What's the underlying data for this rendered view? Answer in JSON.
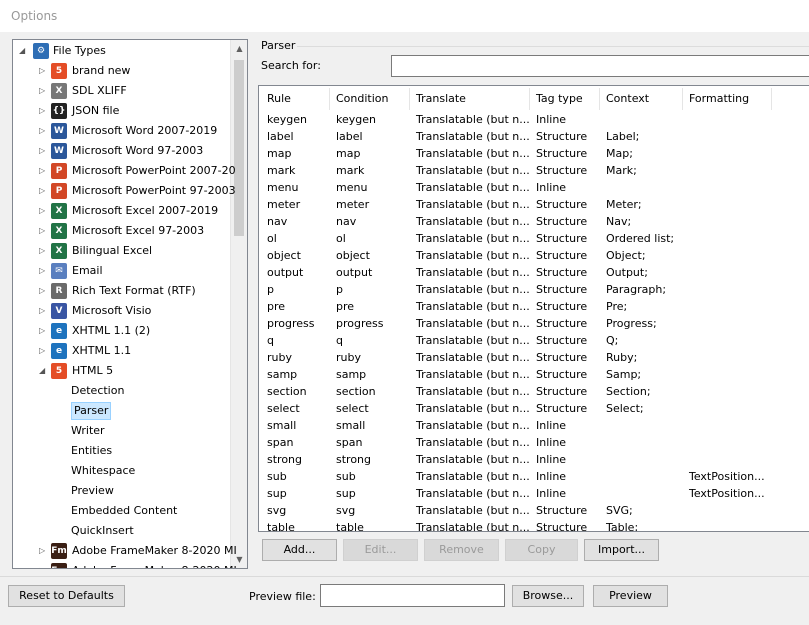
{
  "window": {
    "title": "Options"
  },
  "tree": {
    "items": [
      {
        "label": "File Types",
        "icon": "gear-icon",
        "color": "#2e6eb5",
        "glyph": "⚙"
      },
      {
        "label": "brand new",
        "icon": "html5-icon",
        "color": "#e44d26",
        "glyph": "5"
      },
      {
        "label": "SDL XLIFF",
        "icon": "xliff-icon",
        "color": "#777777",
        "glyph": "X"
      },
      {
        "label": "JSON file",
        "icon": "json-icon",
        "color": "#222222",
        "glyph": "{}"
      },
      {
        "label": "Microsoft Word 2007-2019",
        "icon": "word-icon",
        "color": "#2b579a",
        "glyph": "W"
      },
      {
        "label": "Microsoft Word 97-2003",
        "icon": "word-old-icon",
        "color": "#2b579a",
        "glyph": "W"
      },
      {
        "label": "Microsoft PowerPoint 2007-20",
        "icon": "powerpoint-icon",
        "color": "#d24726",
        "glyph": "P"
      },
      {
        "label": "Microsoft PowerPoint 97-2003",
        "icon": "powerpoint-old-icon",
        "color": "#d24726",
        "glyph": "P"
      },
      {
        "label": "Microsoft Excel 2007-2019",
        "icon": "excel-icon",
        "color": "#217346",
        "glyph": "X"
      },
      {
        "label": "Microsoft Excel 97-2003",
        "icon": "excel-old-icon",
        "color": "#217346",
        "glyph": "X"
      },
      {
        "label": "Bilingual Excel",
        "icon": "bilingual-excel-icon",
        "color": "#217346",
        "glyph": "X"
      },
      {
        "label": "Email",
        "icon": "email-icon",
        "color": "#5a7fbf",
        "glyph": "✉"
      },
      {
        "label": "Rich Text Format (RTF)",
        "icon": "rtf-icon",
        "color": "#6a6a6a",
        "glyph": "R"
      },
      {
        "label": "Microsoft Visio",
        "icon": "visio-icon",
        "color": "#3955a3",
        "glyph": "V"
      },
      {
        "label": "XHTML 1.1 (2)",
        "icon": "xhtml-icon",
        "color": "#1e73be",
        "glyph": "e"
      },
      {
        "label": "XHTML 1.1",
        "icon": "xhtml-icon",
        "color": "#1e73be",
        "glyph": "e"
      },
      {
        "label": "HTML 5",
        "icon": "html5-icon",
        "color": "#e44d26",
        "glyph": "5"
      },
      {
        "label": "Detection"
      },
      {
        "label": "Parser"
      },
      {
        "label": "Writer"
      },
      {
        "label": "Entities"
      },
      {
        "label": "Whitespace"
      },
      {
        "label": "Preview"
      },
      {
        "label": "Embedded Content"
      },
      {
        "label": "QuickInsert"
      },
      {
        "label": "Adobe FrameMaker 8-2020 MI",
        "icon": "framemaker-icon",
        "color": "#3a1f14",
        "glyph": "Fm"
      },
      {
        "label": "Adobe FrameMaker 8-2020 MI",
        "icon": "framemaker-icon",
        "color": "#3a1f14",
        "glyph": "Fm"
      }
    ],
    "selected": "Parser"
  },
  "parser": {
    "group_label": "Parser",
    "search_label": "Search for:",
    "search_value": ""
  },
  "grid": {
    "headers": [
      "Rule",
      "Condition",
      "Translate",
      "Tag type",
      "Context",
      "Formatting"
    ],
    "rows": [
      [
        "keygen",
        "keygen",
        "Translatable (but n...",
        "Inline",
        "",
        ""
      ],
      [
        "label",
        "label",
        "Translatable (but n...",
        "Structure",
        "Label;",
        ""
      ],
      [
        "map",
        "map",
        "Translatable (but n...",
        "Structure",
        "Map;",
        ""
      ],
      [
        "mark",
        "mark",
        "Translatable (but n...",
        "Structure",
        "Mark;",
        ""
      ],
      [
        "menu",
        "menu",
        "Translatable (but n...",
        "Inline",
        "",
        ""
      ],
      [
        "meter",
        "meter",
        "Translatable (but n...",
        "Structure",
        "Meter;",
        ""
      ],
      [
        "nav",
        "nav",
        "Translatable (but n...",
        "Structure",
        "Nav;",
        ""
      ],
      [
        "ol",
        "ol",
        "Translatable (but n...",
        "Structure",
        "Ordered list;",
        ""
      ],
      [
        "object",
        "object",
        "Translatable (but n...",
        "Structure",
        "Object;",
        ""
      ],
      [
        "output",
        "output",
        "Translatable (but n...",
        "Structure",
        "Output;",
        ""
      ],
      [
        "p",
        "p",
        "Translatable (but n...",
        "Structure",
        "Paragraph;",
        ""
      ],
      [
        "pre",
        "pre",
        "Translatable (but n...",
        "Structure",
        "Pre;",
        ""
      ],
      [
        "progress",
        "progress",
        "Translatable (but n...",
        "Structure",
        "Progress;",
        ""
      ],
      [
        "q",
        "q",
        "Translatable (but n...",
        "Structure",
        "Q;",
        ""
      ],
      [
        "ruby",
        "ruby",
        "Translatable (but n...",
        "Structure",
        "Ruby;",
        ""
      ],
      [
        "samp",
        "samp",
        "Translatable (but n...",
        "Structure",
        "Samp;",
        ""
      ],
      [
        "section",
        "section",
        "Translatable (but n...",
        "Structure",
        "Section;",
        ""
      ],
      [
        "select",
        "select",
        "Translatable (but n...",
        "Structure",
        "Select;",
        ""
      ],
      [
        "small",
        "small",
        "Translatable (but n...",
        "Inline",
        "",
        ""
      ],
      [
        "span",
        "span",
        "Translatable (but n...",
        "Inline",
        "",
        ""
      ],
      [
        "strong",
        "strong",
        "Translatable (but n...",
        "Inline",
        "",
        ""
      ],
      [
        "sub",
        "sub",
        "Translatable (but n...",
        "Inline",
        "",
        "TextPosition..."
      ],
      [
        "sup",
        "sup",
        "Translatable (but n...",
        "Inline",
        "",
        "TextPosition..."
      ],
      [
        "svg",
        "svg",
        "Translatable (but n...",
        "Structure",
        "SVG;",
        ""
      ],
      [
        "table",
        "table",
        "Translatable (but n...",
        "Structure",
        "Table;",
        ""
      ]
    ]
  },
  "buttons": {
    "add": "Add...",
    "edit": "Edit...",
    "remove": "Remove",
    "copy": "Copy",
    "import": "Import...",
    "reset": "Reset to Defaults",
    "browse": "Browse...",
    "preview": "Preview"
  },
  "preview_file": {
    "label": "Preview file:",
    "value": ""
  }
}
